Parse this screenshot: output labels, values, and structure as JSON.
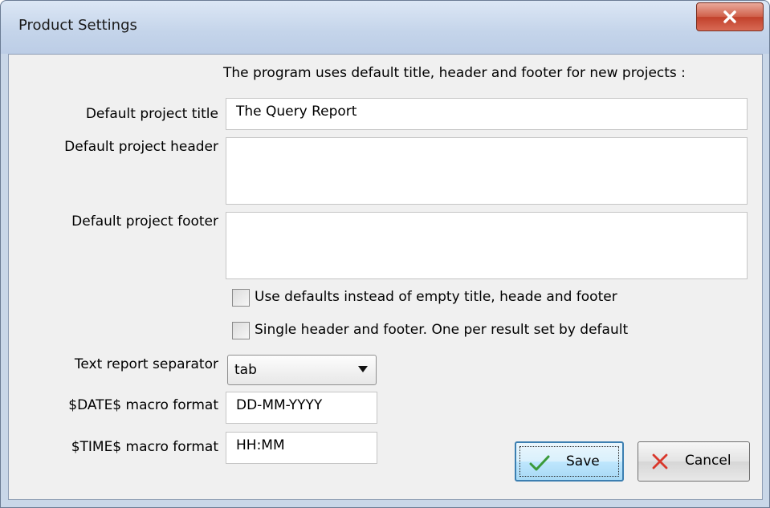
{
  "window": {
    "title": "Product Settings",
    "close_label": "X"
  },
  "intro_text": "The program uses default title, header and footer for new projects :",
  "fields": {
    "title_label": "Default project title",
    "title_value": "The Query Report",
    "header_label": "Default project header",
    "header_value": "",
    "footer_label": "Default project footer",
    "footer_value": ""
  },
  "checkboxes": [
    {
      "label": "Use defaults instead of empty title, heade and footer",
      "checked": false
    },
    {
      "label": "Single header and footer. One per result set by default",
      "checked": false
    }
  ],
  "separator": {
    "label": "Text report separator",
    "value": "tab"
  },
  "date_macro": {
    "label": "$DATE$ macro format",
    "value": "DD-MM-YYYY"
  },
  "time_macro": {
    "label": "$TIME$ macro format",
    "value": "HH:MM"
  },
  "buttons": {
    "save_label": "Save",
    "cancel_label": "Cancel"
  },
  "colors": {
    "save_check": "#3a9a3a",
    "cancel_x": "#d9382c"
  }
}
